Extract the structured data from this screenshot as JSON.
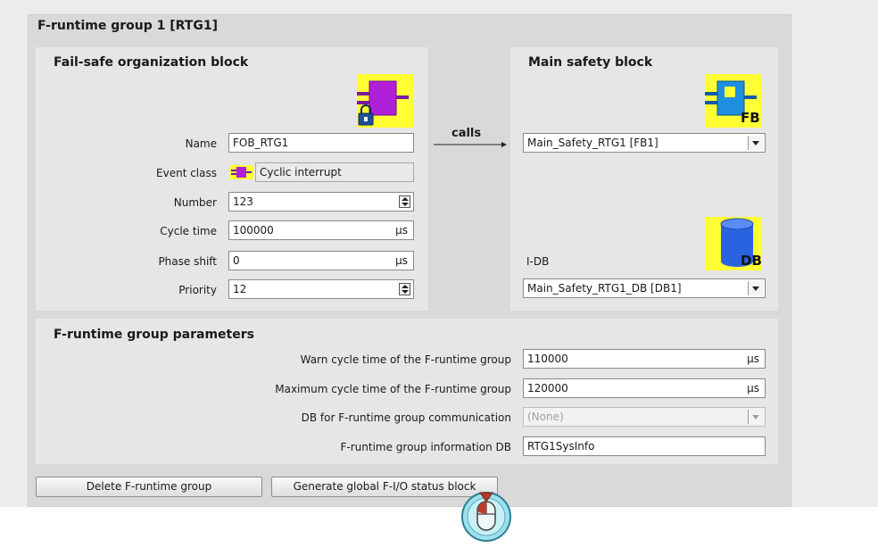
{
  "group": {
    "title": "F-runtime group 1 [RTG1]"
  },
  "fob": {
    "heading": "Fail-safe organization block",
    "name_label": "Name",
    "name_value": "FOB_RTG1",
    "event_label": "Event class",
    "event_value": "Cyclic interrupt",
    "number_label": "Number",
    "number_value": "123",
    "cycle_label": "Cycle time",
    "cycle_value": "100000",
    "cycle_unit": "µs",
    "phase_label": "Phase shift",
    "phase_value": "0",
    "phase_unit": "µs",
    "priority_label": "Priority",
    "priority_value": "12"
  },
  "calls": {
    "label": "calls"
  },
  "msb": {
    "heading": "Main safety block",
    "block_value": "Main_Safety_RTG1 [FB1]",
    "fb_icon_text": "FB",
    "idb_label": "I-DB",
    "idb_value": "Main_Safety_RTG1_DB [DB1]",
    "db_icon_text": "DB"
  },
  "params": {
    "heading": "F-runtime group parameters",
    "warn_label": "Warn cycle time of the F-runtime group",
    "warn_value": "110000",
    "warn_unit": "µs",
    "max_label": "Maximum cycle time of the F-runtime group",
    "max_value": "120000",
    "max_unit": "µs",
    "comm_label": "DB for F-runtime group communication",
    "comm_value": "(None)",
    "info_label": "F-runtime group information DB",
    "info_value": "RTG1SysInfo"
  },
  "buttons": {
    "delete": "Delete F-runtime group",
    "generate": "Generate global F-I/O status block"
  },
  "colors": {
    "icon_bg": "#ffff33",
    "ob_purple": "#b020d8",
    "fb_blue": "#1e8fe0",
    "cursor_teal": "#9fe0ee"
  }
}
